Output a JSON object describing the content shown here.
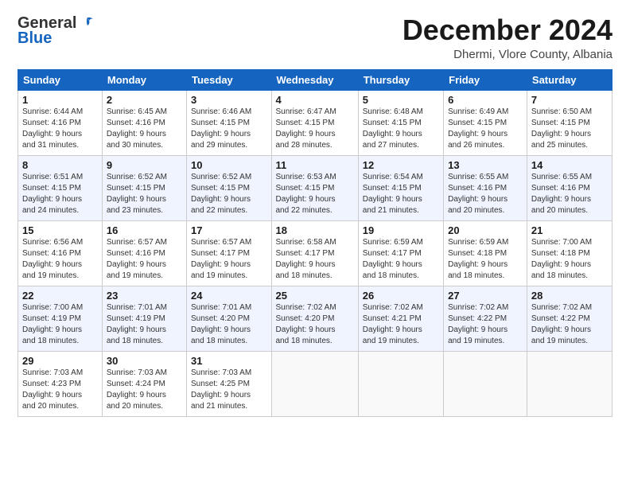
{
  "logo": {
    "general": "General",
    "blue": "Blue"
  },
  "title": "December 2024",
  "subtitle": "Dhermi, Vlore County, Albania",
  "days_header": [
    "Sunday",
    "Monday",
    "Tuesday",
    "Wednesday",
    "Thursday",
    "Friday",
    "Saturday"
  ],
  "weeks": [
    [
      {
        "day": "1",
        "info": "Sunrise: 6:44 AM\nSunset: 4:16 PM\nDaylight: 9 hours\nand 31 minutes."
      },
      {
        "day": "2",
        "info": "Sunrise: 6:45 AM\nSunset: 4:16 PM\nDaylight: 9 hours\nand 30 minutes."
      },
      {
        "day": "3",
        "info": "Sunrise: 6:46 AM\nSunset: 4:15 PM\nDaylight: 9 hours\nand 29 minutes."
      },
      {
        "day": "4",
        "info": "Sunrise: 6:47 AM\nSunset: 4:15 PM\nDaylight: 9 hours\nand 28 minutes."
      },
      {
        "day": "5",
        "info": "Sunrise: 6:48 AM\nSunset: 4:15 PM\nDaylight: 9 hours\nand 27 minutes."
      },
      {
        "day": "6",
        "info": "Sunrise: 6:49 AM\nSunset: 4:15 PM\nDaylight: 9 hours\nand 26 minutes."
      },
      {
        "day": "7",
        "info": "Sunrise: 6:50 AM\nSunset: 4:15 PM\nDaylight: 9 hours\nand 25 minutes."
      }
    ],
    [
      {
        "day": "8",
        "info": "Sunrise: 6:51 AM\nSunset: 4:15 PM\nDaylight: 9 hours\nand 24 minutes."
      },
      {
        "day": "9",
        "info": "Sunrise: 6:52 AM\nSunset: 4:15 PM\nDaylight: 9 hours\nand 23 minutes."
      },
      {
        "day": "10",
        "info": "Sunrise: 6:52 AM\nSunset: 4:15 PM\nDaylight: 9 hours\nand 22 minutes."
      },
      {
        "day": "11",
        "info": "Sunrise: 6:53 AM\nSunset: 4:15 PM\nDaylight: 9 hours\nand 22 minutes."
      },
      {
        "day": "12",
        "info": "Sunrise: 6:54 AM\nSunset: 4:15 PM\nDaylight: 9 hours\nand 21 minutes."
      },
      {
        "day": "13",
        "info": "Sunrise: 6:55 AM\nSunset: 4:16 PM\nDaylight: 9 hours\nand 20 minutes."
      },
      {
        "day": "14",
        "info": "Sunrise: 6:55 AM\nSunset: 4:16 PM\nDaylight: 9 hours\nand 20 minutes."
      }
    ],
    [
      {
        "day": "15",
        "info": "Sunrise: 6:56 AM\nSunset: 4:16 PM\nDaylight: 9 hours\nand 19 minutes."
      },
      {
        "day": "16",
        "info": "Sunrise: 6:57 AM\nSunset: 4:16 PM\nDaylight: 9 hours\nand 19 minutes."
      },
      {
        "day": "17",
        "info": "Sunrise: 6:57 AM\nSunset: 4:17 PM\nDaylight: 9 hours\nand 19 minutes."
      },
      {
        "day": "18",
        "info": "Sunrise: 6:58 AM\nSunset: 4:17 PM\nDaylight: 9 hours\nand 18 minutes."
      },
      {
        "day": "19",
        "info": "Sunrise: 6:59 AM\nSunset: 4:17 PM\nDaylight: 9 hours\nand 18 minutes."
      },
      {
        "day": "20",
        "info": "Sunrise: 6:59 AM\nSunset: 4:18 PM\nDaylight: 9 hours\nand 18 minutes."
      },
      {
        "day": "21",
        "info": "Sunrise: 7:00 AM\nSunset: 4:18 PM\nDaylight: 9 hours\nand 18 minutes."
      }
    ],
    [
      {
        "day": "22",
        "info": "Sunrise: 7:00 AM\nSunset: 4:19 PM\nDaylight: 9 hours\nand 18 minutes."
      },
      {
        "day": "23",
        "info": "Sunrise: 7:01 AM\nSunset: 4:19 PM\nDaylight: 9 hours\nand 18 minutes."
      },
      {
        "day": "24",
        "info": "Sunrise: 7:01 AM\nSunset: 4:20 PM\nDaylight: 9 hours\nand 18 minutes."
      },
      {
        "day": "25",
        "info": "Sunrise: 7:02 AM\nSunset: 4:20 PM\nDaylight: 9 hours\nand 18 minutes."
      },
      {
        "day": "26",
        "info": "Sunrise: 7:02 AM\nSunset: 4:21 PM\nDaylight: 9 hours\nand 19 minutes."
      },
      {
        "day": "27",
        "info": "Sunrise: 7:02 AM\nSunset: 4:22 PM\nDaylight: 9 hours\nand 19 minutes."
      },
      {
        "day": "28",
        "info": "Sunrise: 7:02 AM\nSunset: 4:22 PM\nDaylight: 9 hours\nand 19 minutes."
      }
    ],
    [
      {
        "day": "29",
        "info": "Sunrise: 7:03 AM\nSunset: 4:23 PM\nDaylight: 9 hours\nand 20 minutes."
      },
      {
        "day": "30",
        "info": "Sunrise: 7:03 AM\nSunset: 4:24 PM\nDaylight: 9 hours\nand 20 minutes."
      },
      {
        "day": "31",
        "info": "Sunrise: 7:03 AM\nSunset: 4:25 PM\nDaylight: 9 hours\nand 21 minutes."
      },
      null,
      null,
      null,
      null
    ]
  ]
}
